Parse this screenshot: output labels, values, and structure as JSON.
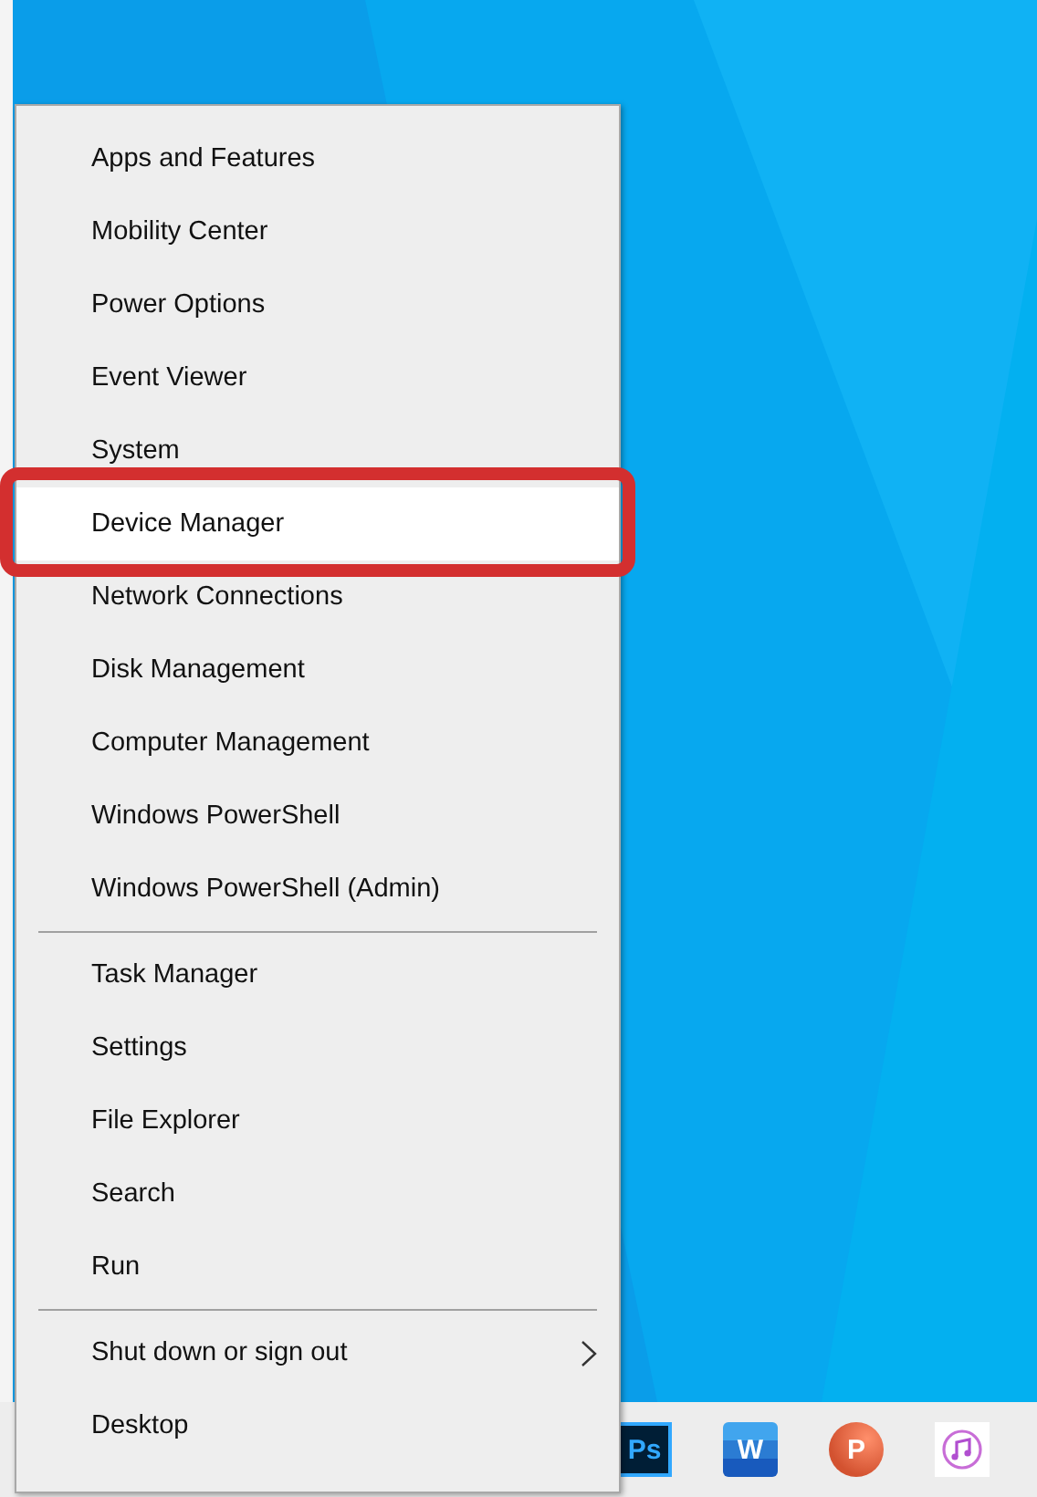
{
  "menu": {
    "sections": [
      [
        {
          "label": "Apps and Features",
          "selected": false
        },
        {
          "label": "Mobility Center",
          "selected": false
        },
        {
          "label": "Power Options",
          "selected": false
        },
        {
          "label": "Event Viewer",
          "selected": false
        },
        {
          "label": "System",
          "selected": false
        },
        {
          "label": "Device Manager",
          "selected": true
        },
        {
          "label": "Network Connections",
          "selected": false
        },
        {
          "label": "Disk Management",
          "selected": false
        },
        {
          "label": "Computer Management",
          "selected": false
        },
        {
          "label": "Windows PowerShell",
          "selected": false
        },
        {
          "label": "Windows PowerShell (Admin)",
          "selected": false
        }
      ],
      [
        {
          "label": "Task Manager",
          "selected": false
        },
        {
          "label": "Settings",
          "selected": false
        },
        {
          "label": "File Explorer",
          "selected": false
        },
        {
          "label": "Search",
          "selected": false
        },
        {
          "label": "Run",
          "selected": false
        }
      ],
      [
        {
          "label": "Shut down or sign out",
          "selected": false,
          "has_submenu": true
        },
        {
          "label": "Desktop",
          "selected": false
        }
      ]
    ]
  },
  "taskbar": {
    "apps": [
      {
        "kind": "photoshop",
        "glyph": "Ps"
      },
      {
        "kind": "word",
        "glyph": "W"
      },
      {
        "kind": "powerpoint",
        "glyph": "P"
      },
      {
        "kind": "music"
      }
    ]
  }
}
